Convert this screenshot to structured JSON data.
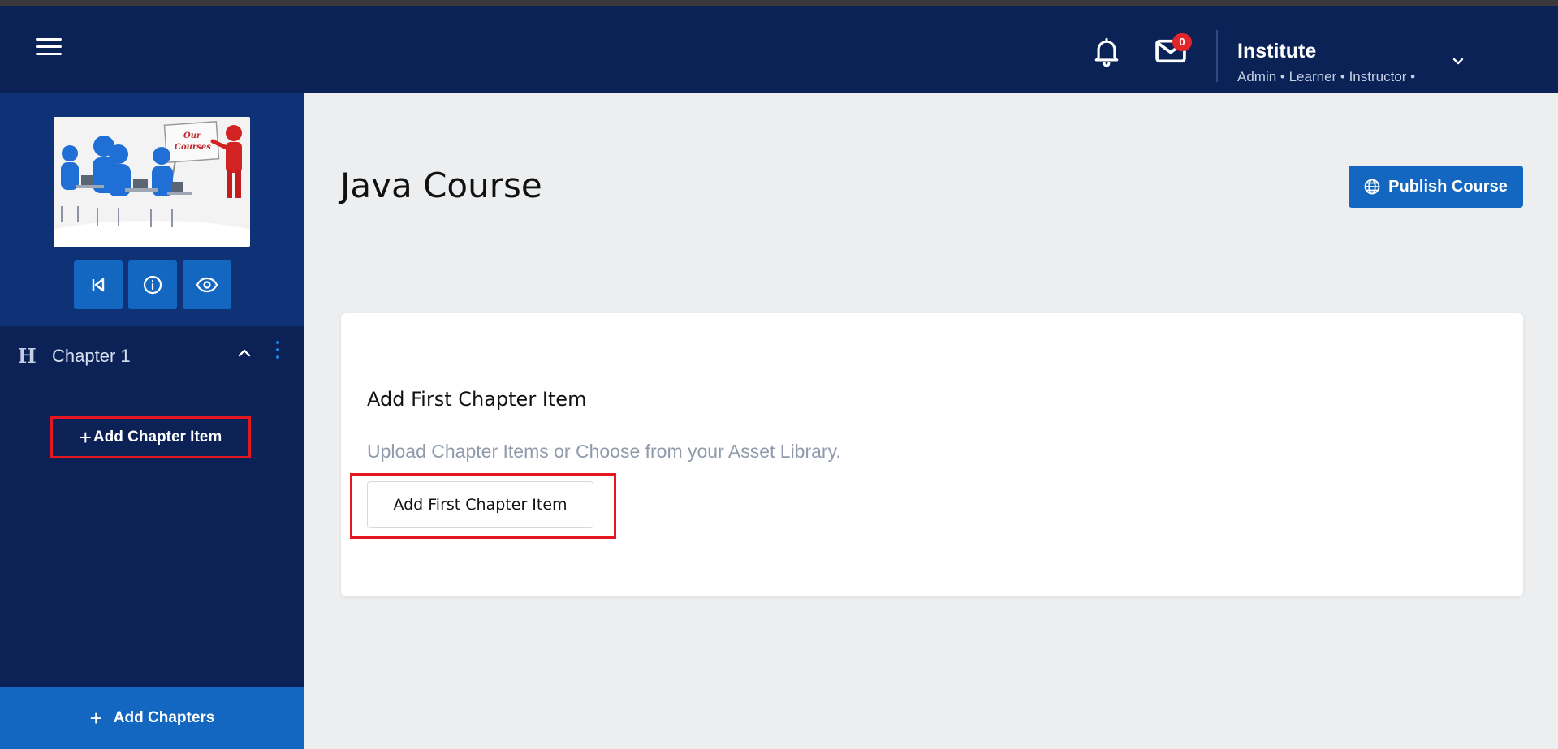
{
  "header": {
    "menu_icon": "hamburger-icon",
    "notification_icon": "bell-icon",
    "mail_icon": "mail-icon",
    "mail_badge": "0",
    "user": {
      "name": "Institute",
      "roles": "Admin • Learner • Instructor •",
      "dropdown_icon": "chevron-down-icon"
    }
  },
  "sidebar": {
    "thumbnail": {
      "caption_line1": "Our",
      "caption_line2": "Courses"
    },
    "controls": [
      {
        "icon": "skip-back-icon"
      },
      {
        "icon": "info-icon"
      },
      {
        "icon": "eye-icon"
      }
    ],
    "chapter": {
      "icon": "heading-icon",
      "glyph": "H",
      "label": "Chapter 1",
      "collapse_icon": "chevron-up-icon",
      "menu_icon": "kebab-menu-icon"
    },
    "add_item_plus": "+",
    "add_item_label": "Add Chapter Item",
    "add_chapters_plus": "+",
    "add_chapters_label": "Add Chapters"
  },
  "main": {
    "title": "Java Course",
    "publish_label": "Publish Course",
    "publish_icon": "globe-icon",
    "card": {
      "title": "Add First Chapter Item",
      "subtitle": "Upload Chapter Items or Choose from your Asset Library.",
      "button_label": "Add First Chapter Item"
    }
  },
  "colors": {
    "navy": "#0b2256",
    "sidebar_top": "#0f3277",
    "accent_blue": "#1467c0",
    "highlight_red": "#e4161f",
    "badge_red": "#e2252b",
    "background": "#edeef0"
  }
}
